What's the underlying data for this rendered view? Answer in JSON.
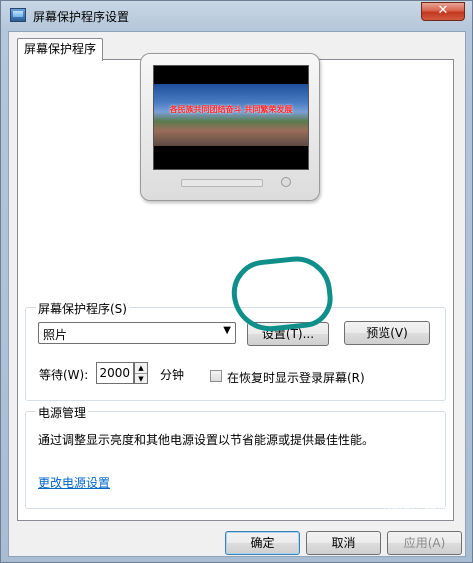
{
  "window": {
    "title": "屏幕保护程序设置",
    "close_label": "✕"
  },
  "tab": {
    "label": "屏幕保护程序"
  },
  "preview": {
    "caption": "各民族共同团结奋斗  共同繁荣发展"
  },
  "screensaver": {
    "group_label": "屏幕保护程序(S)",
    "selected": "照片",
    "settings_button": "设置(T)...",
    "preview_button": "预览(V)",
    "wait_label": "等待(W):",
    "wait_value": "2000",
    "wait_unit": "分钟",
    "resume_label": "在恢复时显示登录屏幕(R)",
    "resume_checked": false
  },
  "power": {
    "group_label": "电源管理",
    "description": "通过调整显示亮度和其他电源设置以节省能源或提供最佳性能。",
    "link": "更改电源设置"
  },
  "buttons": {
    "ok": "确定",
    "cancel": "取消",
    "apply": "应用(A)"
  },
  "watermark": "Baidu 经验",
  "colors": {
    "annotation": "#0f8f8a",
    "link": "#0066cc"
  }
}
